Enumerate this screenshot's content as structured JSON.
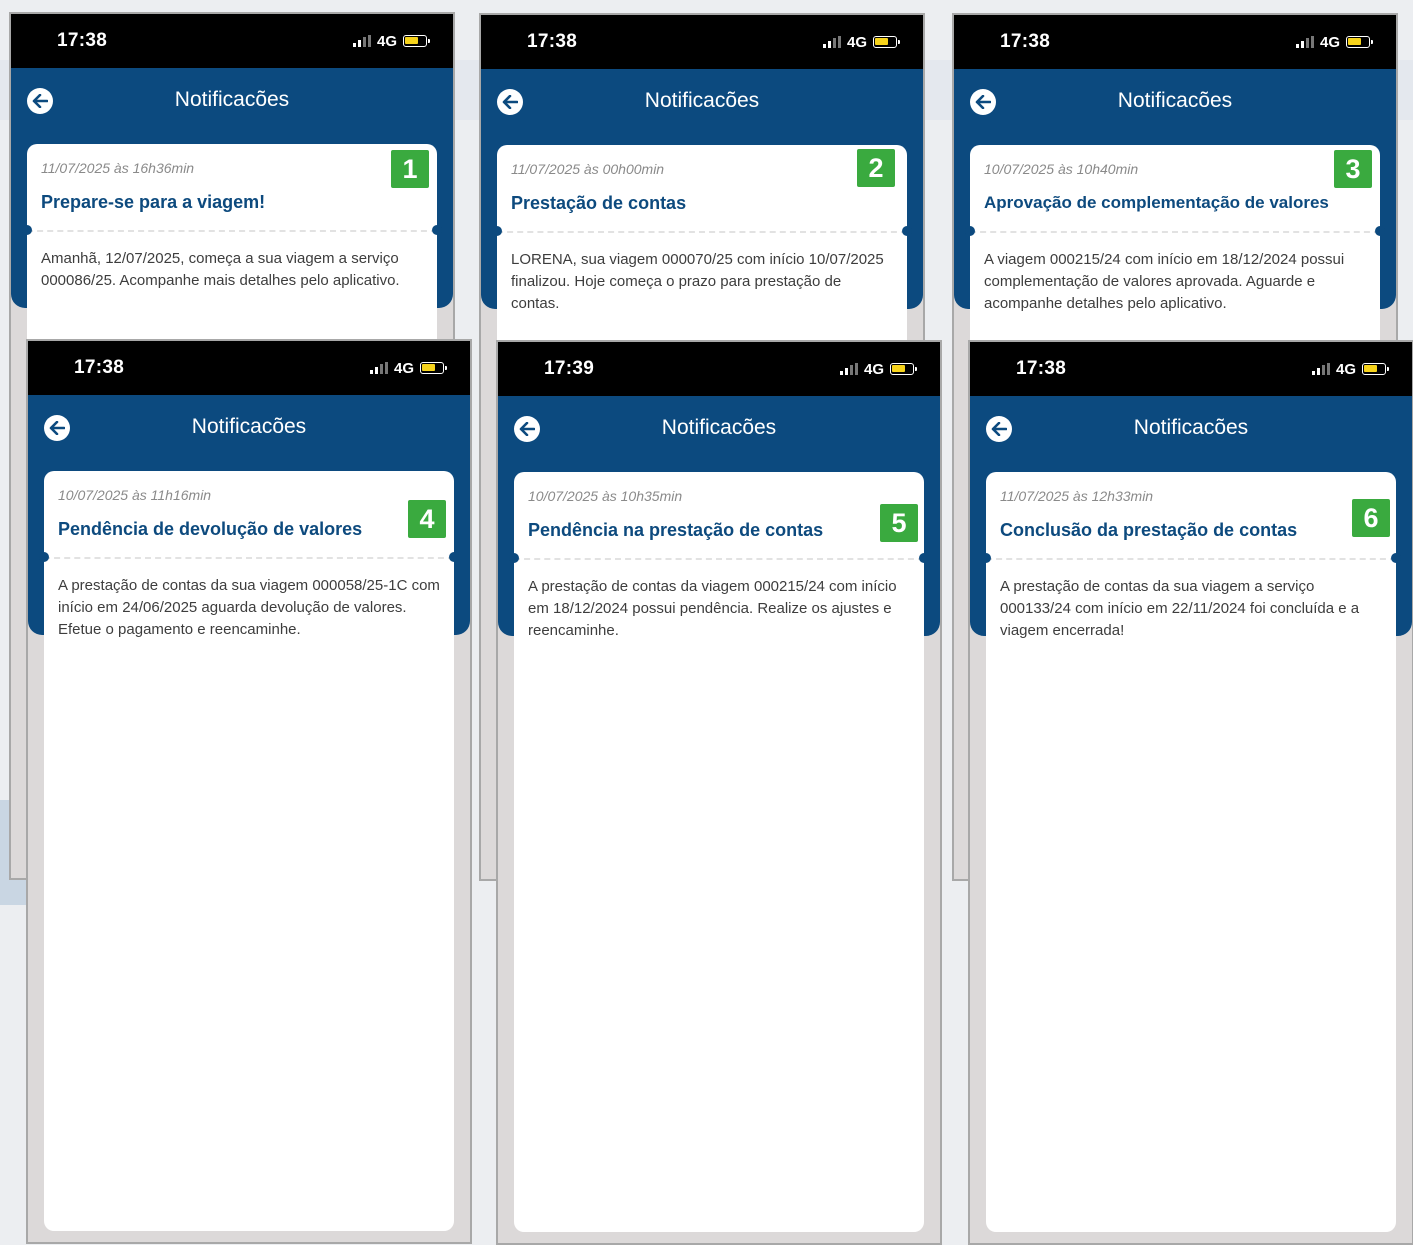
{
  "colors": {
    "header": "#0c4a7f",
    "subject": "#0d4a7e",
    "badge": "#3aaa3f",
    "battery": "#f6d31b"
  },
  "icons": {
    "back": "arrow-left-circle-icon",
    "signal": "signal-bars-icon",
    "battery": "battery-icon"
  },
  "screens": [
    {
      "time": "17:38",
      "network": "4G",
      "title": "Notificacões",
      "badge": "1",
      "notification": {
        "date": "11/07/2025 às 16h36min",
        "subject": "Prepare-se para a viagem!",
        "body": "Amanhã, 12/07/2025, começa a sua viagem a serviço 000086/25. Acompanhe mais detalhes pelo aplicativo."
      }
    },
    {
      "time": "17:38",
      "network": "4G",
      "title": "Notificacões",
      "badge": "2",
      "notification": {
        "date": "11/07/2025 às 00h00min",
        "subject": "Prestação de contas",
        "body": "LORENA, sua viagem 000070/25 com início 10/07/2025 finalizou. Hoje começa o prazo para prestação de contas."
      }
    },
    {
      "time": "17:38",
      "network": "4G",
      "title": "Notificacões",
      "badge": "3",
      "notification": {
        "date": "10/07/2025 às 10h40min",
        "subject": "Aprovação de complementação de valores",
        "body": "A viagem 000215/24 com início em 18/12/2024 possui complementação de valores aprovada. Aguarde e acompanhe detalhes pelo aplicativo."
      }
    },
    {
      "time": "17:38",
      "network": "4G",
      "title": "Notificacões",
      "badge": "4",
      "notification": {
        "date": "10/07/2025 às 11h16min",
        "subject": "Pendência de devolução de valores",
        "body": "A prestação de contas da sua viagem 000058/25-1C com início em 24/06/2025 aguarda devolução de valores. Efetue o pagamento e reencaminhe."
      }
    },
    {
      "time": "17:39",
      "network": "4G",
      "title": "Notificacões",
      "badge": "5",
      "notification": {
        "date": "10/07/2025 às 10h35min",
        "subject": "Pendência na prestação de contas",
        "body": "A prestação de contas da viagem 000215/24 com início em 18/12/2024 possui pendência. Realize os ajustes e reencaminhe."
      }
    },
    {
      "time": "17:38",
      "network": "4G",
      "title": "Notificacões",
      "badge": "6",
      "notification": {
        "date": "11/07/2025 às 12h33min",
        "subject": "Conclusão da prestação de contas",
        "body": "A prestação de contas da sua viagem a serviço 000133/24 com início em 22/11/2024 foi concluída e a viagem encerrada!"
      }
    }
  ]
}
